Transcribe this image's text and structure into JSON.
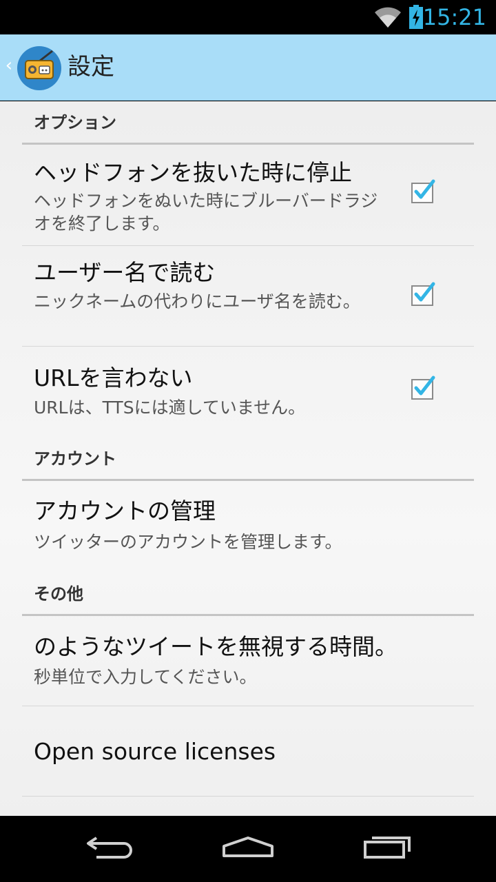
{
  "status_bar": {
    "time": "15:21",
    "icons": [
      "wifi-icon",
      "battery-charging-icon"
    ],
    "accent_color": "#33b5e5"
  },
  "action_bar": {
    "title": "設定",
    "app_icon": "radio-icon",
    "background_color": "#a9ddf8"
  },
  "sections": {
    "options": {
      "header": "オプション",
      "items": [
        {
          "title": "ヘッドフォンを抜いた時に停止",
          "summary": "ヘッドフォンをぬいた時にブルーバードラジオを終了します。",
          "checked": true
        },
        {
          "title": "ユーザー名で読む",
          "summary": "ニックネームの代わりにユーザ名を読む。",
          "checked": true
        },
        {
          "title": "URLを言わない",
          "summary": "URLは、TTSには適していません。",
          "checked": true
        }
      ]
    },
    "account": {
      "header": "アカウント",
      "items": [
        {
          "title": "アカウントの管理",
          "summary": "ツイッターのアカウントを管理します。"
        }
      ]
    },
    "other": {
      "header": "その他",
      "items": [
        {
          "title": "のようなツイートを無視する時間。",
          "summary": "秒単位で入力してください。"
        },
        {
          "title": "Open source licenses"
        }
      ]
    }
  },
  "nav_bar": {
    "buttons": [
      "back-icon",
      "home-icon",
      "recent-apps-icon"
    ]
  }
}
